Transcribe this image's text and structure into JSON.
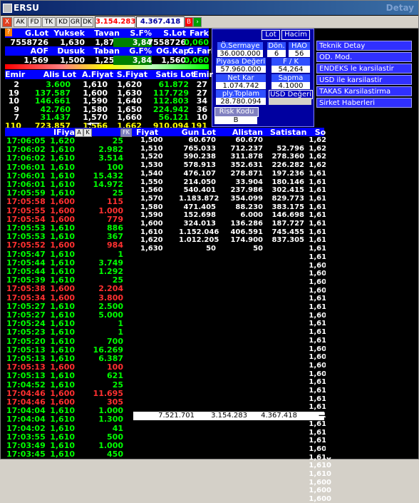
{
  "window": {
    "title": "ERSU",
    "right_title": "Detay"
  },
  "toolbar": {
    "buttons": [
      "X",
      "AK",
      "FD",
      "TK",
      "KD",
      "GR",
      "DK"
    ],
    "value1": "3.154.283",
    "value2": "4.367.418",
    "b_label": "B"
  },
  "summary": {
    "headers1": [
      "G.Lot",
      "Yuksek",
      "Tavan",
      "S.F%",
      "S.Lot",
      "Fark"
    ],
    "values1": [
      "7558726",
      "1,630",
      "1,870",
      "3,84",
      "7558726",
      "0,060"
    ],
    "headers2": [
      "AOF",
      "Dusuk",
      "Taban",
      "G.F%",
      "OG.Kap.",
      "G.Fark"
    ],
    "values2": [
      "1,569",
      "1,500",
      "1,250",
      "3,84",
      "1,560",
      "0,060"
    ]
  },
  "depth": {
    "headers": [
      "Emir",
      "Alis Lot",
      "A.Fiyat",
      "S.Fiyat",
      "Satis Lot",
      "Emir"
    ],
    "rows": [
      [
        "2",
        "3.600",
        "1,610",
        "1,620",
        "61.872",
        "27"
      ],
      [
        "19",
        "137.587",
        "1,600",
        "1,630",
        "117.729",
        "27"
      ],
      [
        "10",
        "146.661",
        "1,590",
        "1,640",
        "112.803",
        "34"
      ],
      [
        "9",
        "42.760",
        "1,580",
        "1,650",
        "224.942",
        "36"
      ],
      [
        "7",
        "31.437",
        "1,570",
        "1,660",
        "56.121",
        "10"
      ],
      [
        "110",
        "723.857",
        "1,566",
        "1,662",
        "910.094",
        "191"
      ]
    ]
  },
  "info_panel": {
    "lot_label": "Lot",
    "hacim_label": "Hacim",
    "osermaye_label": "Ö.Sermaye",
    "osermaye": "36.000.000",
    "don_label": "Dön.",
    "don": "6",
    "hao_label": "HAO",
    "hao": "56",
    "piyasa_label": "Piyasa Değeri",
    "piyasa": "57.960.000",
    "fk_label": "F / K",
    "fk": "54,264",
    "netkar_label": "Net Kar",
    "netkar": "1.074.742",
    "sapma_label": "Sapma",
    "sapma": "4.1000",
    "ply_label": "ply.Toplam Lot",
    "ply": "28.780.094",
    "usd_label": "USD Değeri",
    "risk_label": "Risk Kodu",
    "risk": "B"
  },
  "side_buttons": [
    "Teknik Detay",
    "OD. Mod.",
    "ENDEKS le karsilastir",
    "USD ile karsilastir",
    "TAKAS Karsilastirma",
    "Sirket Haberleri"
  ],
  "trades": {
    "header_price": "IFiyat",
    "rows": [
      [
        "17:06:05",
        "1,620",
        "25",
        "g"
      ],
      [
        "17:06:02",
        "1,610",
        "2.982",
        "g"
      ],
      [
        "17:06:02",
        "1,610",
        "3.514",
        "g"
      ],
      [
        "17:06:01",
        "1,610",
        "100",
        "g"
      ],
      [
        "17:06:01",
        "1,610",
        "15.432",
        "g"
      ],
      [
        "17:06:01",
        "1,610",
        "14.972",
        "g"
      ],
      [
        "17:05:59",
        "1,610",
        "25",
        "g"
      ],
      [
        "17:05:58",
        "1,600",
        "115",
        "r"
      ],
      [
        "17:05:55",
        "1,600",
        "1.000",
        "r"
      ],
      [
        "17:05:54",
        "1,600",
        "779",
        "r"
      ],
      [
        "17:05:53",
        "1,610",
        "886",
        "g"
      ],
      [
        "17:05:53",
        "1,610",
        "367",
        "g"
      ],
      [
        "17:05:52",
        "1,600",
        "984",
        "r"
      ],
      [
        "17:05:47",
        "1,610",
        "1",
        "g"
      ],
      [
        "17:05:44",
        "1,610",
        "3.749",
        "g"
      ],
      [
        "17:05:44",
        "1,610",
        "1.292",
        "g"
      ],
      [
        "17:05:39",
        "1,610",
        "25",
        "g"
      ],
      [
        "17:05:38",
        "1,600",
        "2.204",
        "r"
      ],
      [
        "17:05:34",
        "1,600",
        "3.800",
        "r"
      ],
      [
        "17:05:27",
        "1,610",
        "2.500",
        "g"
      ],
      [
        "17:05:27",
        "1,610",
        "5.000",
        "g"
      ],
      [
        "17:05:24",
        "1,610",
        "1",
        "g"
      ],
      [
        "17:05:23",
        "1,610",
        "1",
        "g"
      ],
      [
        "17:05:20",
        "1,610",
        "700",
        "g"
      ],
      [
        "17:05:13",
        "1,610",
        "16.269",
        "g"
      ],
      [
        "17:05:13",
        "1,610",
        "6.387",
        "g"
      ],
      [
        "17:05:13",
        "1,600",
        "100",
        "r"
      ],
      [
        "17:05:13",
        "1,610",
        "621",
        "g"
      ],
      [
        "17:04:52",
        "1,610",
        "25",
        "g"
      ],
      [
        "17:04:46",
        "1,600",
        "11.695",
        "r"
      ],
      [
        "17:04:46",
        "1,600",
        "305",
        "r"
      ],
      [
        "17:04:04",
        "1,610",
        "1.000",
        "g"
      ],
      [
        "17:04:04",
        "1,610",
        "1.300",
        "g"
      ],
      [
        "17:04:02",
        "1,610",
        "41",
        "g"
      ],
      [
        "17:03:55",
        "1,610",
        "500",
        "g"
      ],
      [
        "17:03:49",
        "1,610",
        "1.000",
        "g"
      ],
      [
        "17:03:45",
        "1,610",
        "450",
        "g"
      ]
    ]
  },
  "distribution": {
    "headers": [
      "Fiyat",
      "Gun Lot",
      "Alistan",
      "Satistan",
      "Son"
    ],
    "rows": [
      [
        "1,500",
        "60.670",
        "60.670",
        "",
        "1,620"
      ],
      [
        "1,510",
        "765.033",
        "712.237",
        "52.796",
        "1,620"
      ],
      [
        "1,520",
        "590.238",
        "311.878",
        "278.360",
        "1,620"
      ],
      [
        "1,530",
        "578.913",
        "352.631",
        "226.282",
        "1,620"
      ],
      [
        "1,540",
        "476.107",
        "278.871",
        "197.236",
        "1,610"
      ],
      [
        "1,550",
        "214.050",
        "33.904",
        "180.146",
        "1,610"
      ],
      [
        "1,560",
        "540.401",
        "237.986",
        "302.415",
        "1,610"
      ],
      [
        "1,570",
        "1.183.872",
        "354.099",
        "829.773",
        "1,610"
      ],
      [
        "1,580",
        "471.405",
        "88.230",
        "383.175",
        "1,610"
      ],
      [
        "1,590",
        "152.698",
        "6.000",
        "146.698",
        "1,610"
      ],
      [
        "1,600",
        "324.013",
        "136.286",
        "187.727",
        "1,610"
      ],
      [
        "1,610",
        "1.152.046",
        "406.591",
        "745.455",
        "1,610"
      ],
      [
        "1,620",
        "1.012.205",
        "174.900",
        "837.305",
        "1,610"
      ],
      [
        "1,630",
        "50",
        "50",
        "",
        "1,610"
      ]
    ],
    "son_rest": [
      "1,610",
      "1,600",
      "1,600",
      "1,600",
      "1,600",
      "1,610",
      "1,610",
      "1,600",
      "1,610",
      "1,610",
      "1,610",
      "1,600",
      "1,600",
      "1,600",
      "1,600",
      "1,610",
      "1,610",
      "1,610",
      "1,610",
      "1,610",
      "1,610",
      "1,610",
      "1,610",
      "1,600",
      "1,610",
      "1,610",
      "1,610",
      "1,600",
      "1,600",
      "1,600"
    ],
    "totals": [
      "7.521.701",
      "3.154.283",
      "4.367.418"
    ]
  }
}
